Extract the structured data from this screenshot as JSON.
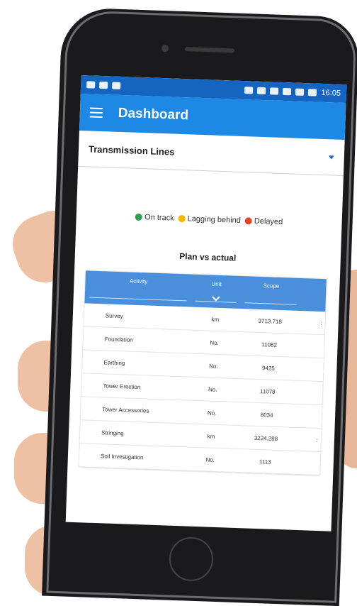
{
  "status_bar": {
    "time": "16:05"
  },
  "app_bar": {
    "title": "Dashboard"
  },
  "dropdown": {
    "selected": "Transmission Lines"
  },
  "legend": [
    {
      "label": "On track",
      "color": "#2e9e4f"
    },
    {
      "label": "Lagging behind",
      "color": "#f5b400"
    },
    {
      "label": "Delayed",
      "color": "#e0452e"
    }
  ],
  "section_title": "Plan vs actual",
  "table": {
    "columns": [
      "Activity",
      "Unit",
      "Scope"
    ],
    "rows": [
      {
        "activity": "Survey",
        "unit": "km",
        "scope": "3713.718",
        "more": ":"
      },
      {
        "activity": "Foundation",
        "unit": "No.",
        "scope": "11082",
        "more": ""
      },
      {
        "activity": "Earthing",
        "unit": "No.",
        "scope": "9425",
        "more": ""
      },
      {
        "activity": "Tower Erection",
        "unit": "No.",
        "scope": "11078",
        "more": ""
      },
      {
        "activity": "Tower Accessories",
        "unit": "No.",
        "scope": "8034",
        "more": ""
      },
      {
        "activity": "Stringing",
        "unit": "km",
        "scope": "3224.288",
        "more": ":"
      },
      {
        "activity": "Soil Investigation",
        "unit": "No.",
        "scope": "1113",
        "more": ""
      }
    ]
  },
  "colors": {
    "app_bar": "#1e88e5",
    "status_bar": "#1565c0",
    "table_header": "#4a8fdc"
  }
}
